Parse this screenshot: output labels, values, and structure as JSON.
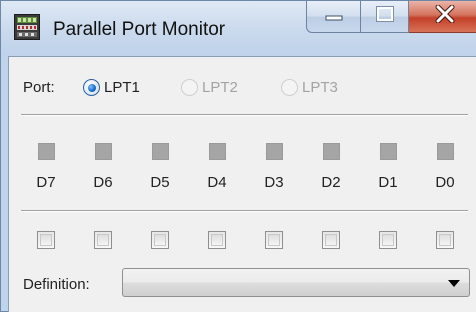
{
  "window": {
    "title": "Parallel Port Monitor",
    "icon": "parallel-port-app-icon"
  },
  "caption_buttons": {
    "minimize": "minimize-icon",
    "maximize": "maximize-icon",
    "close": "close-icon"
  },
  "port": {
    "label": "Port:",
    "options": [
      {
        "label": "LPT1",
        "selected": true,
        "enabled": true
      },
      {
        "label": "LPT2",
        "selected": false,
        "enabled": false
      },
      {
        "label": "LPT3",
        "selected": false,
        "enabled": false
      }
    ]
  },
  "data_bits": {
    "labels": [
      "D7",
      "D6",
      "D5",
      "D4",
      "D3",
      "D2",
      "D1",
      "D0"
    ],
    "indicator_states": [
      false,
      false,
      false,
      false,
      false,
      false,
      false,
      false
    ],
    "checkbox_states": [
      false,
      false,
      false,
      false,
      false,
      false,
      false,
      false
    ]
  },
  "definition": {
    "label": "Definition:",
    "selected_value": ""
  },
  "colors": {
    "titlebar": "#cddcee",
    "close_button": "#c4402a",
    "indicator_off": "#a5a5a5",
    "selected_radio": "#1f6fc8"
  }
}
